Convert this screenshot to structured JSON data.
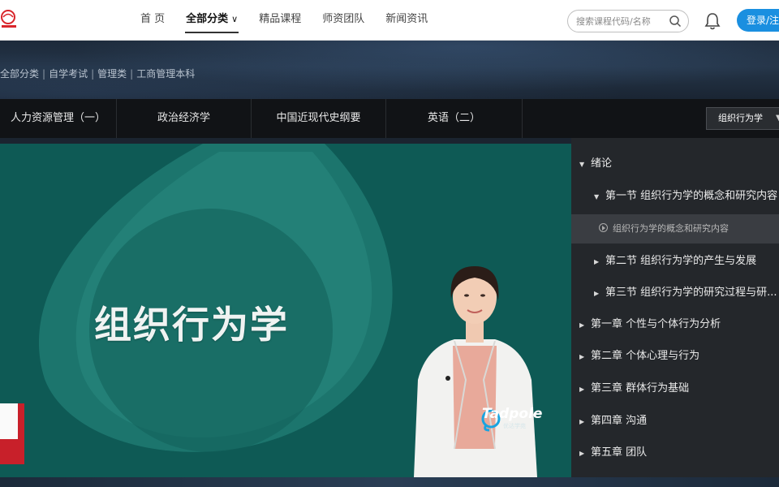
{
  "nav": {
    "items": [
      {
        "label": "首 页"
      },
      {
        "label": "全部分类"
      },
      {
        "label": "精品课程"
      },
      {
        "label": "师资团队"
      },
      {
        "label": "新闻资讯"
      }
    ],
    "search_placeholder": "搜索课程代码/名称",
    "login_label": "登录/注册"
  },
  "breadcrumb": [
    "全部分类",
    "自学考试",
    "管理类",
    "工商管理本科"
  ],
  "course_tabs": [
    "人力资源管理（一）",
    "政治经济学",
    "中国近现代史纲要",
    "英语（二）"
  ],
  "course_select": {
    "value": "组织行为学"
  },
  "video": {
    "slide_title": "组织行为学",
    "brand": "Tadpole",
    "brand_sub": "优达学苑"
  },
  "chapters": [
    {
      "label": "绪论",
      "level": 0,
      "expanded": true
    },
    {
      "label": "第一节 组织行为学的概念和研究内容",
      "level": 1,
      "expanded": true
    },
    {
      "label": "组织行为学的概念和研究内容",
      "level": 2,
      "active": true
    },
    {
      "label": "第二节 组织行为学的产生与发展",
      "level": 1
    },
    {
      "label": "第三节 组织行为学的研究过程与研...",
      "level": 1
    },
    {
      "label": "第一章 个性与个体行为分析",
      "level": 0
    },
    {
      "label": "第二章 个体心理与行为",
      "level": 0
    },
    {
      "label": "第三章 群体行为基础",
      "level": 0
    },
    {
      "label": "第四章 沟通",
      "level": 0
    },
    {
      "label": "第五章 团队",
      "level": 0
    }
  ],
  "colors": {
    "accent": "#1a8fe0",
    "video_bg": "#0d5e58",
    "panel_bg": "#24272b"
  }
}
